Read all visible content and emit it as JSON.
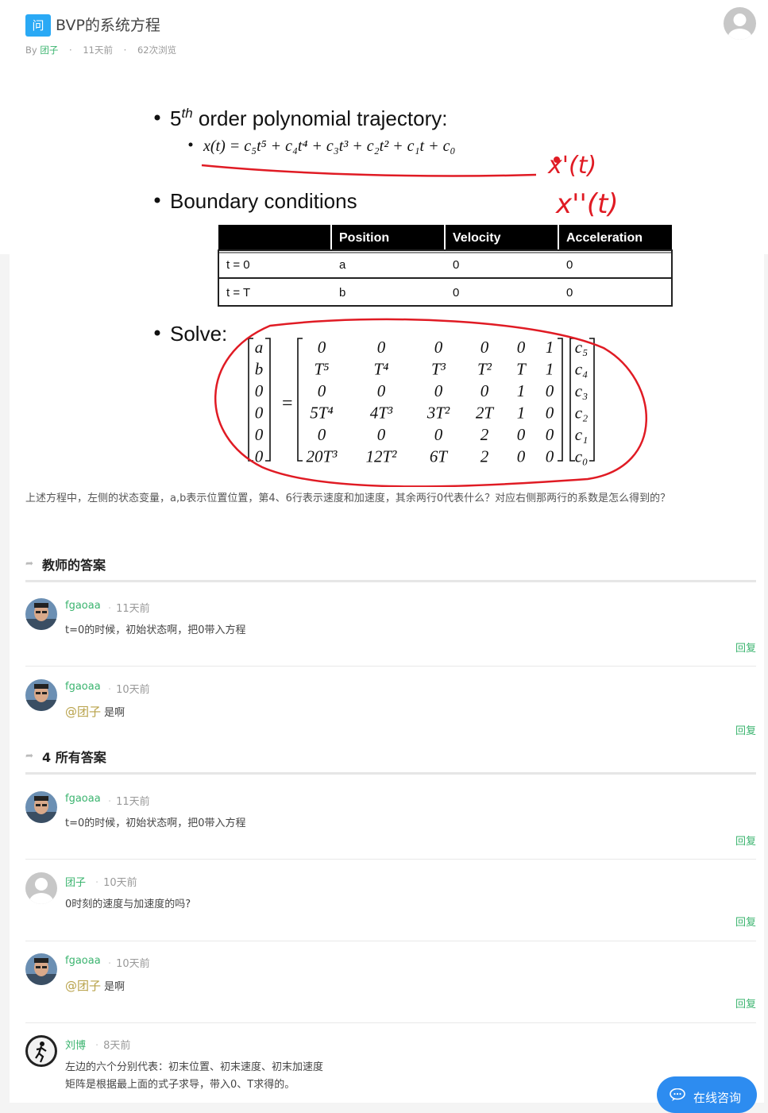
{
  "question": {
    "badge": "问",
    "title": "BVP的系统方程",
    "by_label": "By",
    "author": "团子",
    "posted": "11天前",
    "views": "62次浏览",
    "body": "上述方程中，左侧的状态变量，a,b表示位置位置，第4、6行表示速度和加速度，其余两行0代表什么？对应右侧那两行的系数是怎么得到的？"
  },
  "slide": {
    "bullet1_prefix": "5",
    "bullet1_sup": "th",
    "bullet1_text": " order polynomial trajectory:",
    "equation": "x(t) = c₅t⁵ + c₄t⁴ + c₃t³ + c₂t² + c₁t + c₀",
    "handwritten_1": "x'(t)",
    "handwritten_2": "x''(t)",
    "bullet2": "Boundary conditions",
    "table": {
      "headers": [
        "",
        "Position",
        "Velocity",
        "Acceleration"
      ],
      "rows": [
        [
          "t = 0",
          "a",
          "0",
          "0"
        ],
        [
          "t = T",
          "b",
          "0",
          "0"
        ]
      ]
    },
    "bullet3": "Solve:",
    "lhs": [
      "a",
      "b",
      "0",
      "0",
      "0",
      "0"
    ],
    "matrix": [
      [
        "0",
        "0",
        "0",
        "0",
        "0",
        "1"
      ],
      [
        "T⁵",
        "T⁴",
        "T³",
        "T²",
        "T",
        "1"
      ],
      [
        "0",
        "0",
        "0",
        "0",
        "1",
        "0"
      ],
      [
        "5T⁴",
        "4T³",
        "3T²",
        "2T",
        "1",
        "0"
      ],
      [
        "0",
        "0",
        "0",
        "2",
        "0",
        "0"
      ],
      [
        "20T³",
        "12T²",
        "6T",
        "2",
        "0",
        "0"
      ]
    ],
    "rhs": [
      "c₅",
      "c₄",
      "c₃",
      "c₂",
      "c₁",
      "c₀"
    ]
  },
  "sections": {
    "teacher": "教师的答案",
    "all": "4 所有答案"
  },
  "reply_label": "回复",
  "answers": [
    {
      "name": "fgaoaa",
      "time": "11天前",
      "text": "t=0的时候，初始状态啊，把0带入方程"
    },
    {
      "name": "fgaoaa",
      "time": "10天前",
      "mention": "@团子",
      "text": "是啊"
    },
    {
      "name": "fgaoaa",
      "time": "11天前",
      "text": "t=0的时候，初始状态啊，把0带入方程"
    },
    {
      "name": "团子",
      "time": "10天前",
      "text": "0时刻的速度与加速度的吗?"
    },
    {
      "name": "fgaoaa",
      "time": "10天前",
      "mention": "@团子",
      "text": "是啊"
    },
    {
      "name": "刘博",
      "time": "8天前",
      "text": "左边的六个分别代表：初末位置、初末速度、初末加速度",
      "text2": "矩阵是根据最上面的式子求导，带入0、T求得的。"
    }
  ],
  "consult": "在线咨询",
  "icons": {
    "section_arrow": "share-arrow-icon",
    "consult": "chat-bubble-icon"
  }
}
